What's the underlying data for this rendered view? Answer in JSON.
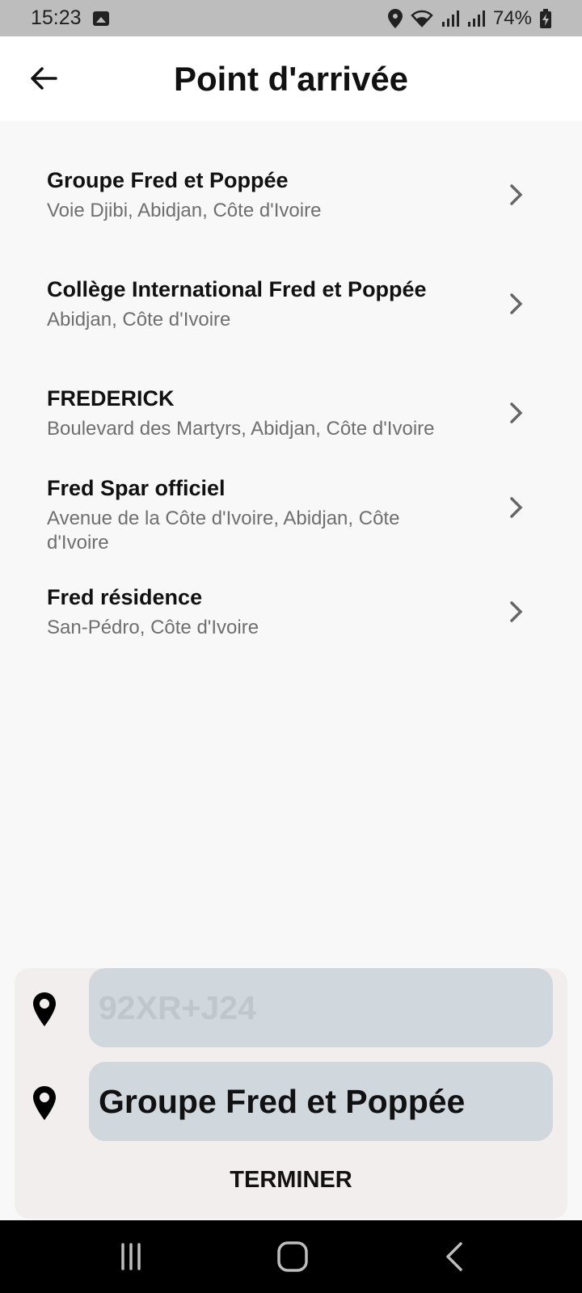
{
  "status_bar": {
    "time": "15:23",
    "battery": "74%",
    "icons": [
      "gallery-icon",
      "location-icon",
      "wifi-icon",
      "signal-icon",
      "signal-icon",
      "battery-charging-icon"
    ]
  },
  "header": {
    "title": "Point d'arrivée",
    "back_icon": "arrow-left-icon"
  },
  "results": [
    {
      "name": "Groupe Fred et Poppée",
      "address": "Voie Djibi, Abidjan, Côte d'Ivoire"
    },
    {
      "name": "Collège International Fred et Poppée",
      "address": "Abidjan, Côte d'Ivoire"
    },
    {
      "name": "FREDERICK",
      "address": "Boulevard des Martyrs, Abidjan, Côte d'Ivoire"
    },
    {
      "name": "Fred Spar officiel",
      "address": "Avenue de la Côte d'Ivoire, Abidjan, Côte d'Ivoire"
    },
    {
      "name": "Fred résidence",
      "address": "San-Pédro, Côte d'Ivoire"
    }
  ],
  "route_panel": {
    "origin_value": "92XR+J24",
    "destination_value": "Groupe Fred et Poppée",
    "finish_label": "TERMINER"
  },
  "colors": {
    "status_bar": "#bdbdbd",
    "appbar": "#ffffff",
    "background": "#f8f8f8",
    "panel": "#f3eeee",
    "field": "#d0d8de",
    "subtitle": "#6f6f6f"
  }
}
